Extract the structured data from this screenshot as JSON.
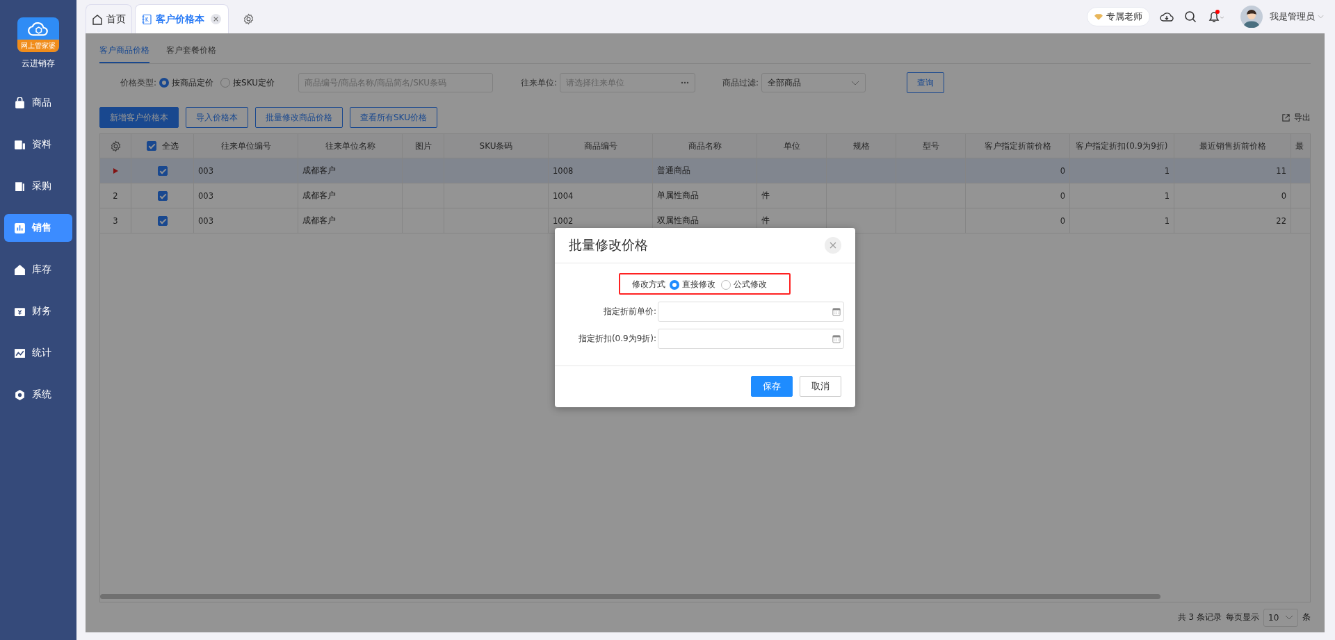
{
  "app": {
    "logo_text": "网上管家婆",
    "name": "云进销存"
  },
  "sidebar": {
    "items": [
      {
        "label": "商品",
        "selected": false
      },
      {
        "label": "资料",
        "selected": false
      },
      {
        "label": "采购",
        "selected": false
      },
      {
        "label": "销售",
        "selected": true
      },
      {
        "label": "库存",
        "selected": false
      },
      {
        "label": "财务",
        "selected": false
      },
      {
        "label": "统计",
        "selected": false
      },
      {
        "label": "系统",
        "selected": false
      }
    ]
  },
  "tabs": [
    {
      "kind": "home",
      "label": "首页",
      "selected": false
    },
    {
      "kind": "page",
      "label": "客户价格本",
      "selected": true
    }
  ],
  "header": {
    "teacher": "专属老师",
    "notifications_unread": true,
    "user": "我是管理员"
  },
  "subtabs": [
    {
      "label": "客户商品价格",
      "selected": true
    },
    {
      "label": "客户套餐价格",
      "selected": false
    }
  ],
  "filters": {
    "price_type_label": "价格类型:",
    "price_types": [
      {
        "label": "按商品定价",
        "selected": true
      },
      {
        "label": "按SKU定价",
        "selected": false
      }
    ],
    "search_placeholder": "商品编号/商品名称/商品简名/SKU条码",
    "partner_label": "往来单位:",
    "partner_placeholder": "请选择往来单位",
    "product_filter_label": "商品过滤:",
    "product_filter_value": "全部商品",
    "query_button": "查询"
  },
  "actions": [
    {
      "kind": "primary",
      "label": "新增客户价格本"
    },
    {
      "kind": "default",
      "label": "导入价格本"
    },
    {
      "kind": "default",
      "label": "批量修改商品价格"
    },
    {
      "kind": "default",
      "label": "查看所有SKU价格"
    }
  ],
  "export_label": "导出",
  "table": {
    "select_all_label": "全选",
    "select_all_checked": true,
    "columns": [
      "往来单位编号",
      "往来单位名称",
      "图片",
      "SKU条码",
      "商品编号",
      "商品名称",
      "单位",
      "规格",
      "型号",
      "客户指定折前价格",
      "客户指定折扣(0.9为9折)",
      "最近销售折前价格",
      "最"
    ],
    "rows": [
      {
        "current": true,
        "checked": true,
        "cells": {
          "partner_code": "003",
          "partner_name": "成都客户",
          "product_code": "1008",
          "product_name": "普通商品",
          "price_before": "0",
          "discount": "1",
          "recent_price": "11"
        }
      },
      {
        "current": false,
        "index": "2",
        "checked": true,
        "cells": {
          "partner_code": "003",
          "partner_name": "成都客户",
          "product_code": "1004",
          "product_name": "单属性商品",
          "unit": "件",
          "price_before": "0",
          "discount": "1",
          "recent_price": "0"
        }
      },
      {
        "current": false,
        "index": "3",
        "checked": true,
        "cells": {
          "partner_code": "003",
          "partner_name": "成都客户",
          "product_code": "1002",
          "product_name": "双属性商品",
          "unit": "件",
          "price_before": "0",
          "discount": "1",
          "recent_price": "22"
        }
      }
    ]
  },
  "pagination": {
    "summary": "共 3 条记录",
    "per_page_label": "每页显示",
    "page_size": "10",
    "unit": "条"
  },
  "dialog": {
    "title": "批量修改价格",
    "mode_label": "修改方式",
    "modes": [
      {
        "label": "直接修改",
        "selected": true
      },
      {
        "label": "公式修改",
        "selected": false
      }
    ],
    "fields": [
      {
        "label": "指定折前单价:"
      },
      {
        "label": "指定折扣(0.9为9折):"
      }
    ],
    "save": "保存",
    "cancel": "取消"
  }
}
